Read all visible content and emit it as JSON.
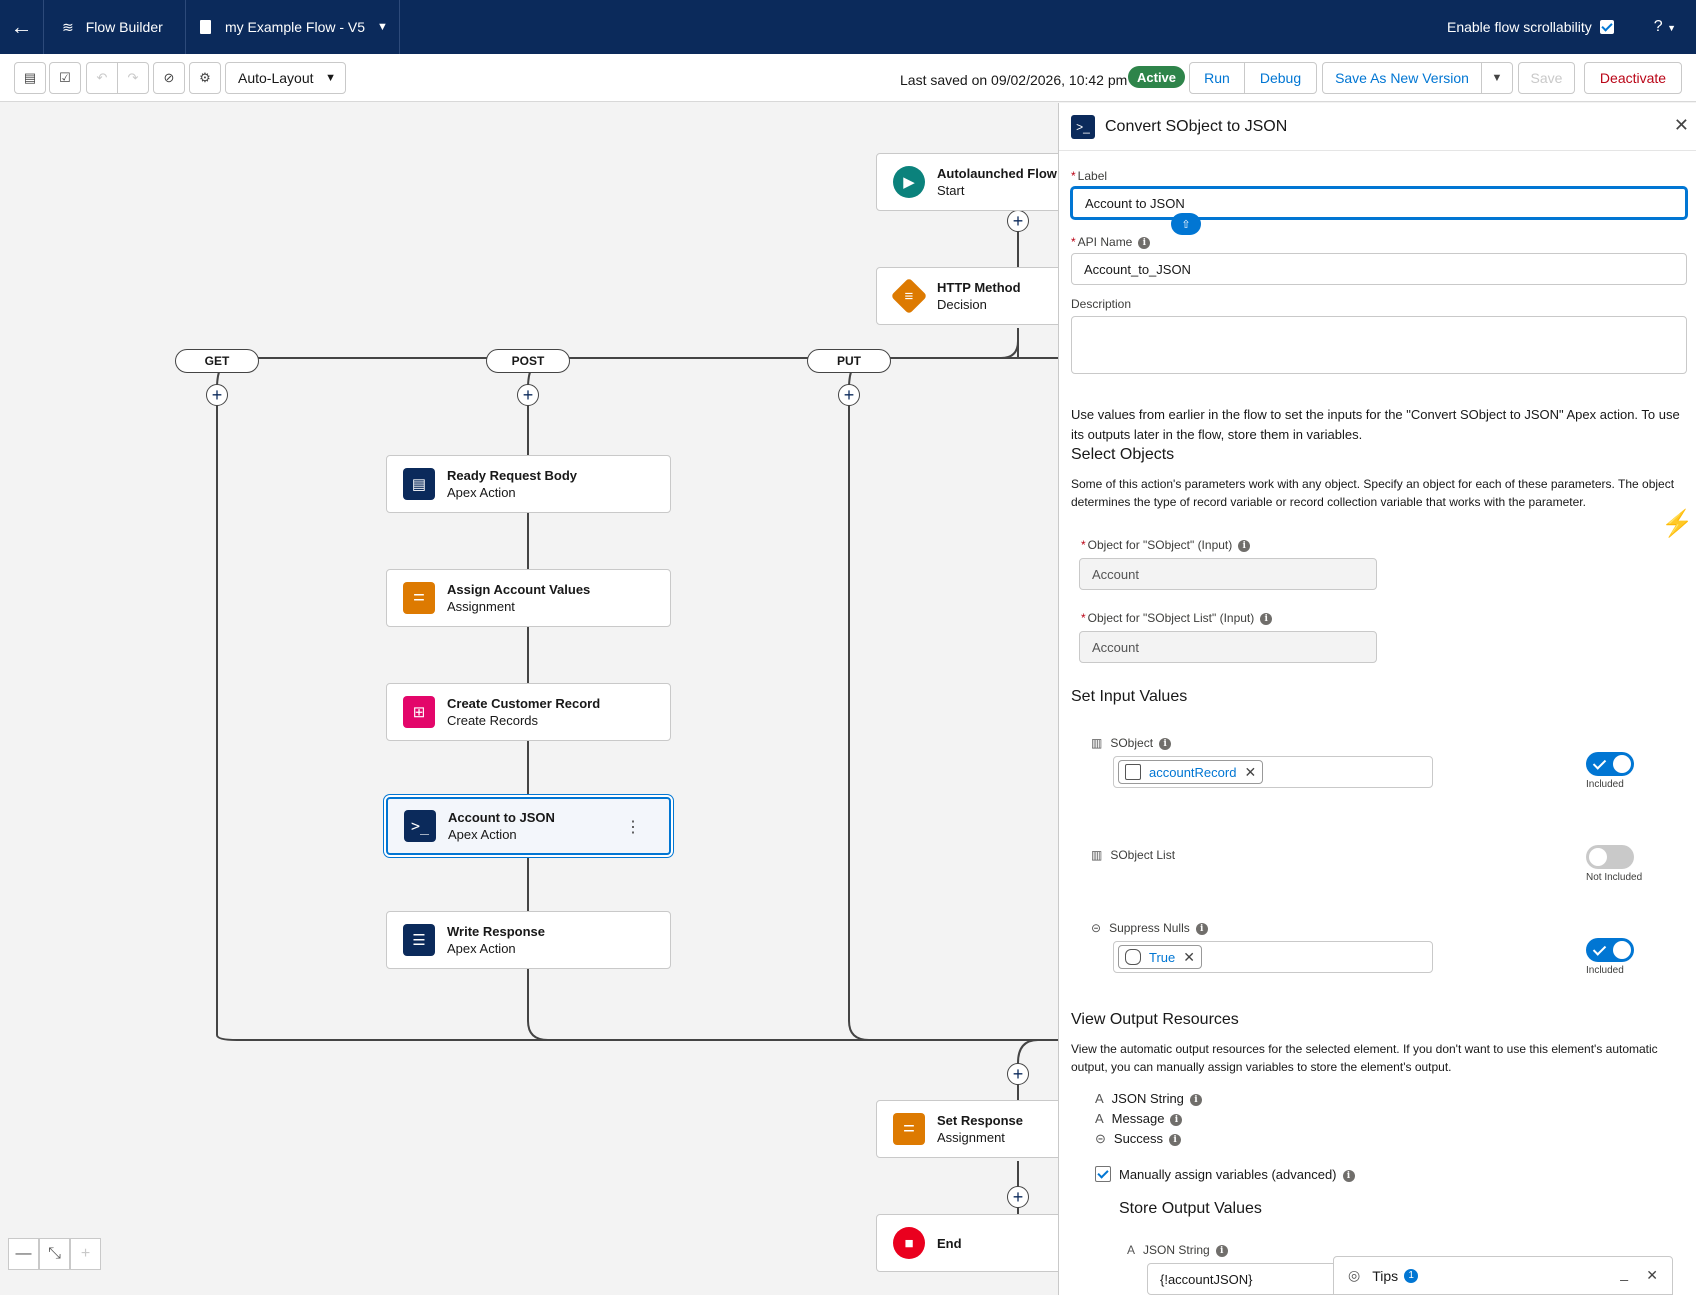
{
  "topbar": {
    "back": "←",
    "app_name": "Flow Builder",
    "flow_name": "my Example Flow - V5",
    "scroll_label": "Enable flow scrollability",
    "scroll_checked": true,
    "help": "?"
  },
  "toolbar": {
    "layout": "Auto-Layout",
    "last_saved": "Last saved on 09/02/2026, 10:42 pm",
    "status": "Active",
    "run": "Run",
    "debug": "Debug",
    "save_as": "Save As New Version",
    "save": "Save",
    "deactivate": "Deactivate"
  },
  "canvas": {
    "nodes": [
      {
        "title": "Autolaunched Flow",
        "subtitle": "Start"
      },
      {
        "title": "HTTP Method",
        "subtitle": "Decision"
      },
      {
        "title": "Ready Request Body",
        "subtitle": "Apex Action"
      },
      {
        "title": "Assign Account Values",
        "subtitle": "Assignment"
      },
      {
        "title": "Create Customer Record",
        "subtitle": "Create Records"
      },
      {
        "title": "Account to JSON",
        "subtitle": "Apex Action"
      },
      {
        "title": "Write Response",
        "subtitle": "Apex Action"
      },
      {
        "title": "Set Response",
        "subtitle": "Assignment"
      },
      {
        "title": "End",
        "subtitle": ""
      }
    ],
    "branches": [
      "GET",
      "POST",
      "PUT"
    ]
  },
  "panel": {
    "title": "Convert SObject to JSON",
    "label_label": "Label",
    "label_value": "Account to JSON",
    "api_label": "API Name",
    "api_value": "Account_to_JSON",
    "desc_label": "Description",
    "intro": "Use values from earlier in the flow to set the inputs for the \"Convert SObject to JSON\" Apex action. To use its outputs later in the flow, store them in variables.",
    "select_objects": "Select Objects",
    "select_text": "Some of this action's parameters work with any object. Specify an object for each of these parameters. The object determines the type of record variable or record collection variable that works with the parameter.",
    "obj1_label": "Object for \"SObject\" (Input)",
    "obj1_value": "Account",
    "obj2_label": "Object for \"SObject List\" (Input)",
    "obj2_value": "Account",
    "set_inputs": "Set Input Values",
    "inputs": [
      {
        "name": "SObject",
        "value": "accountRecord",
        "state": "Included",
        "on": true
      },
      {
        "name": "SObject List",
        "value": "",
        "state": "Not Included",
        "on": false
      },
      {
        "name": "Suppress Nulls",
        "value": "True",
        "state": "Included",
        "on": true
      }
    ],
    "view_outputs": "View Output Resources",
    "outputs_text": "View the automatic output resources for the selected element. If you don't want to use this element's automatic output, you can manually assign variables to store the element's output.",
    "outputs": [
      "JSON String",
      "Message",
      "Success"
    ],
    "manual": "Manually assign variables (advanced)",
    "store": "Store Output Values",
    "store_field": "JSON String",
    "store_value": "{!accountJSON}"
  },
  "tips": {
    "label": "Tips",
    "count": "1"
  }
}
